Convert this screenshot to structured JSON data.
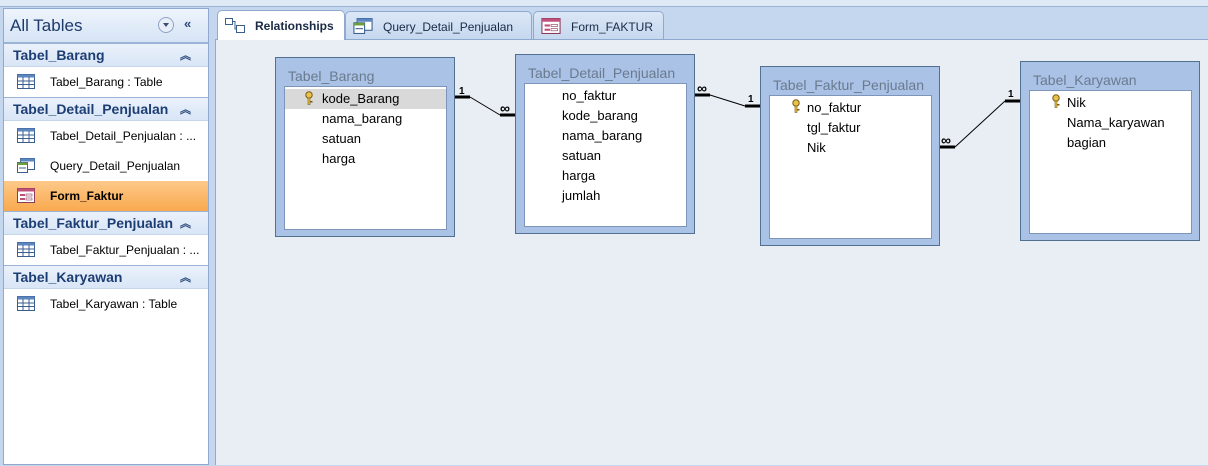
{
  "nav": {
    "title": "All Tables",
    "groups": [
      {
        "title": "Tabel_Barang",
        "items": [
          {
            "label": "Tabel_Barang : Table",
            "icon": "table-icon"
          }
        ]
      },
      {
        "title": "Tabel_Detail_Penjualan",
        "items": [
          {
            "label": "Tabel_Detail_Penjualan : ...",
            "icon": "table-icon"
          },
          {
            "label": "Query_Detail_Penjualan",
            "icon": "query-icon"
          },
          {
            "label": "Form_Faktur",
            "icon": "form-icon",
            "selected": true
          }
        ]
      },
      {
        "title": "Tabel_Faktur_Penjualan",
        "items": [
          {
            "label": "Tabel_Faktur_Penjualan : ...",
            "icon": "table-icon"
          }
        ]
      },
      {
        "title": "Tabel_Karyawan",
        "items": [
          {
            "label": "Tabel_Karyawan : Table",
            "icon": "table-icon"
          }
        ]
      }
    ]
  },
  "tabs": [
    {
      "label": "Relationships",
      "active": true,
      "icon": "relationships-icon"
    },
    {
      "label": "Query_Detail_Penjualan",
      "icon": "query-icon"
    },
    {
      "label": "Form_FAKTUR",
      "icon": "form-icon"
    }
  ],
  "tables": {
    "barang": {
      "title": "Tabel_Barang",
      "fields": [
        "kode_Barang",
        "nama_barang",
        "satuan",
        "harga"
      ]
    },
    "detail": {
      "title": "Tabel_Detail_Penjualan",
      "fields": [
        "no_faktur",
        "kode_barang",
        "nama_barang",
        "satuan",
        "harga",
        "jumlah"
      ]
    },
    "faktur": {
      "title": "Tabel_Faktur_Penjualan",
      "fields": [
        "no_faktur",
        "tgl_faktur",
        "Nik"
      ]
    },
    "karyawan": {
      "title": "Tabel_Karyawan",
      "fields": [
        "Nik",
        "Nama_karyawan",
        "bagian"
      ]
    }
  },
  "relationships": {
    "one_label": "1",
    "many_label": "∞"
  },
  "colors": {
    "accent": "#1d3e74",
    "selected": "#fbb869",
    "canvas": "#e9eef4"
  }
}
